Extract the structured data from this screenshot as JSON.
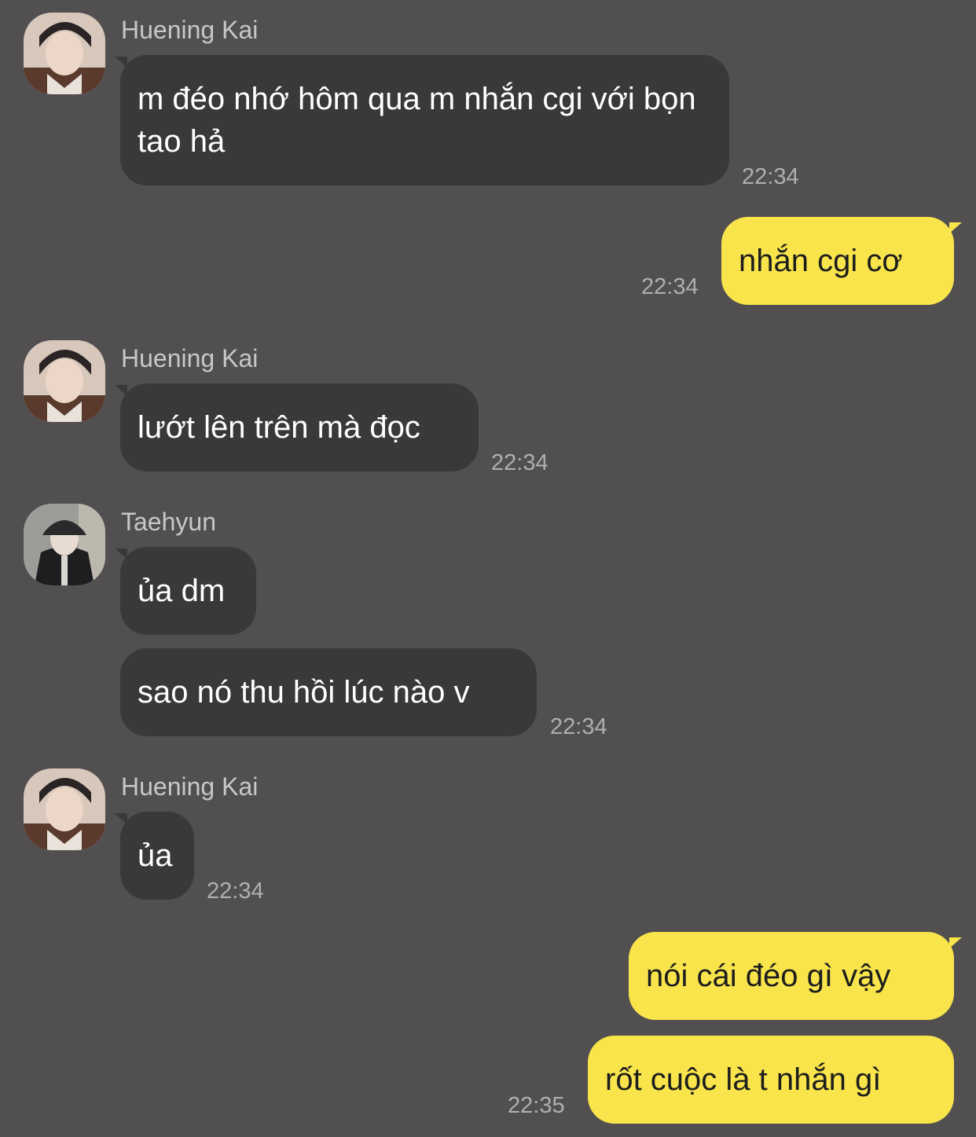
{
  "chat": {
    "messages": [
      {
        "sender": "Huening Kai",
        "text": "m đéo nhớ hôm qua m nhắn cgi với bọn tao hả",
        "time": "22:34"
      },
      {
        "sender": "me",
        "text": "nhắn cgi cơ",
        "time": "22:34"
      },
      {
        "sender": "Huening Kai",
        "text": "lướt lên trên mà đọc",
        "time": "22:34"
      },
      {
        "sender": "Taehyun",
        "text": "ủa dm",
        "time": ""
      },
      {
        "sender": "Taehyun",
        "text": "sao nó thu hồi lúc nào v",
        "time": "22:34"
      },
      {
        "sender": "Huening Kai",
        "text": "ủa",
        "time": "22:34"
      },
      {
        "sender": "me",
        "text": "nói cái đéo gì vậy",
        "time": ""
      },
      {
        "sender": "me",
        "text": "rốt cuộc là t nhắn gì",
        "time": "22:35"
      }
    ]
  },
  "colors": {
    "background": "#514f50",
    "incoming_bubble": "#39393b",
    "outgoing_bubble": "#f9e54b"
  }
}
